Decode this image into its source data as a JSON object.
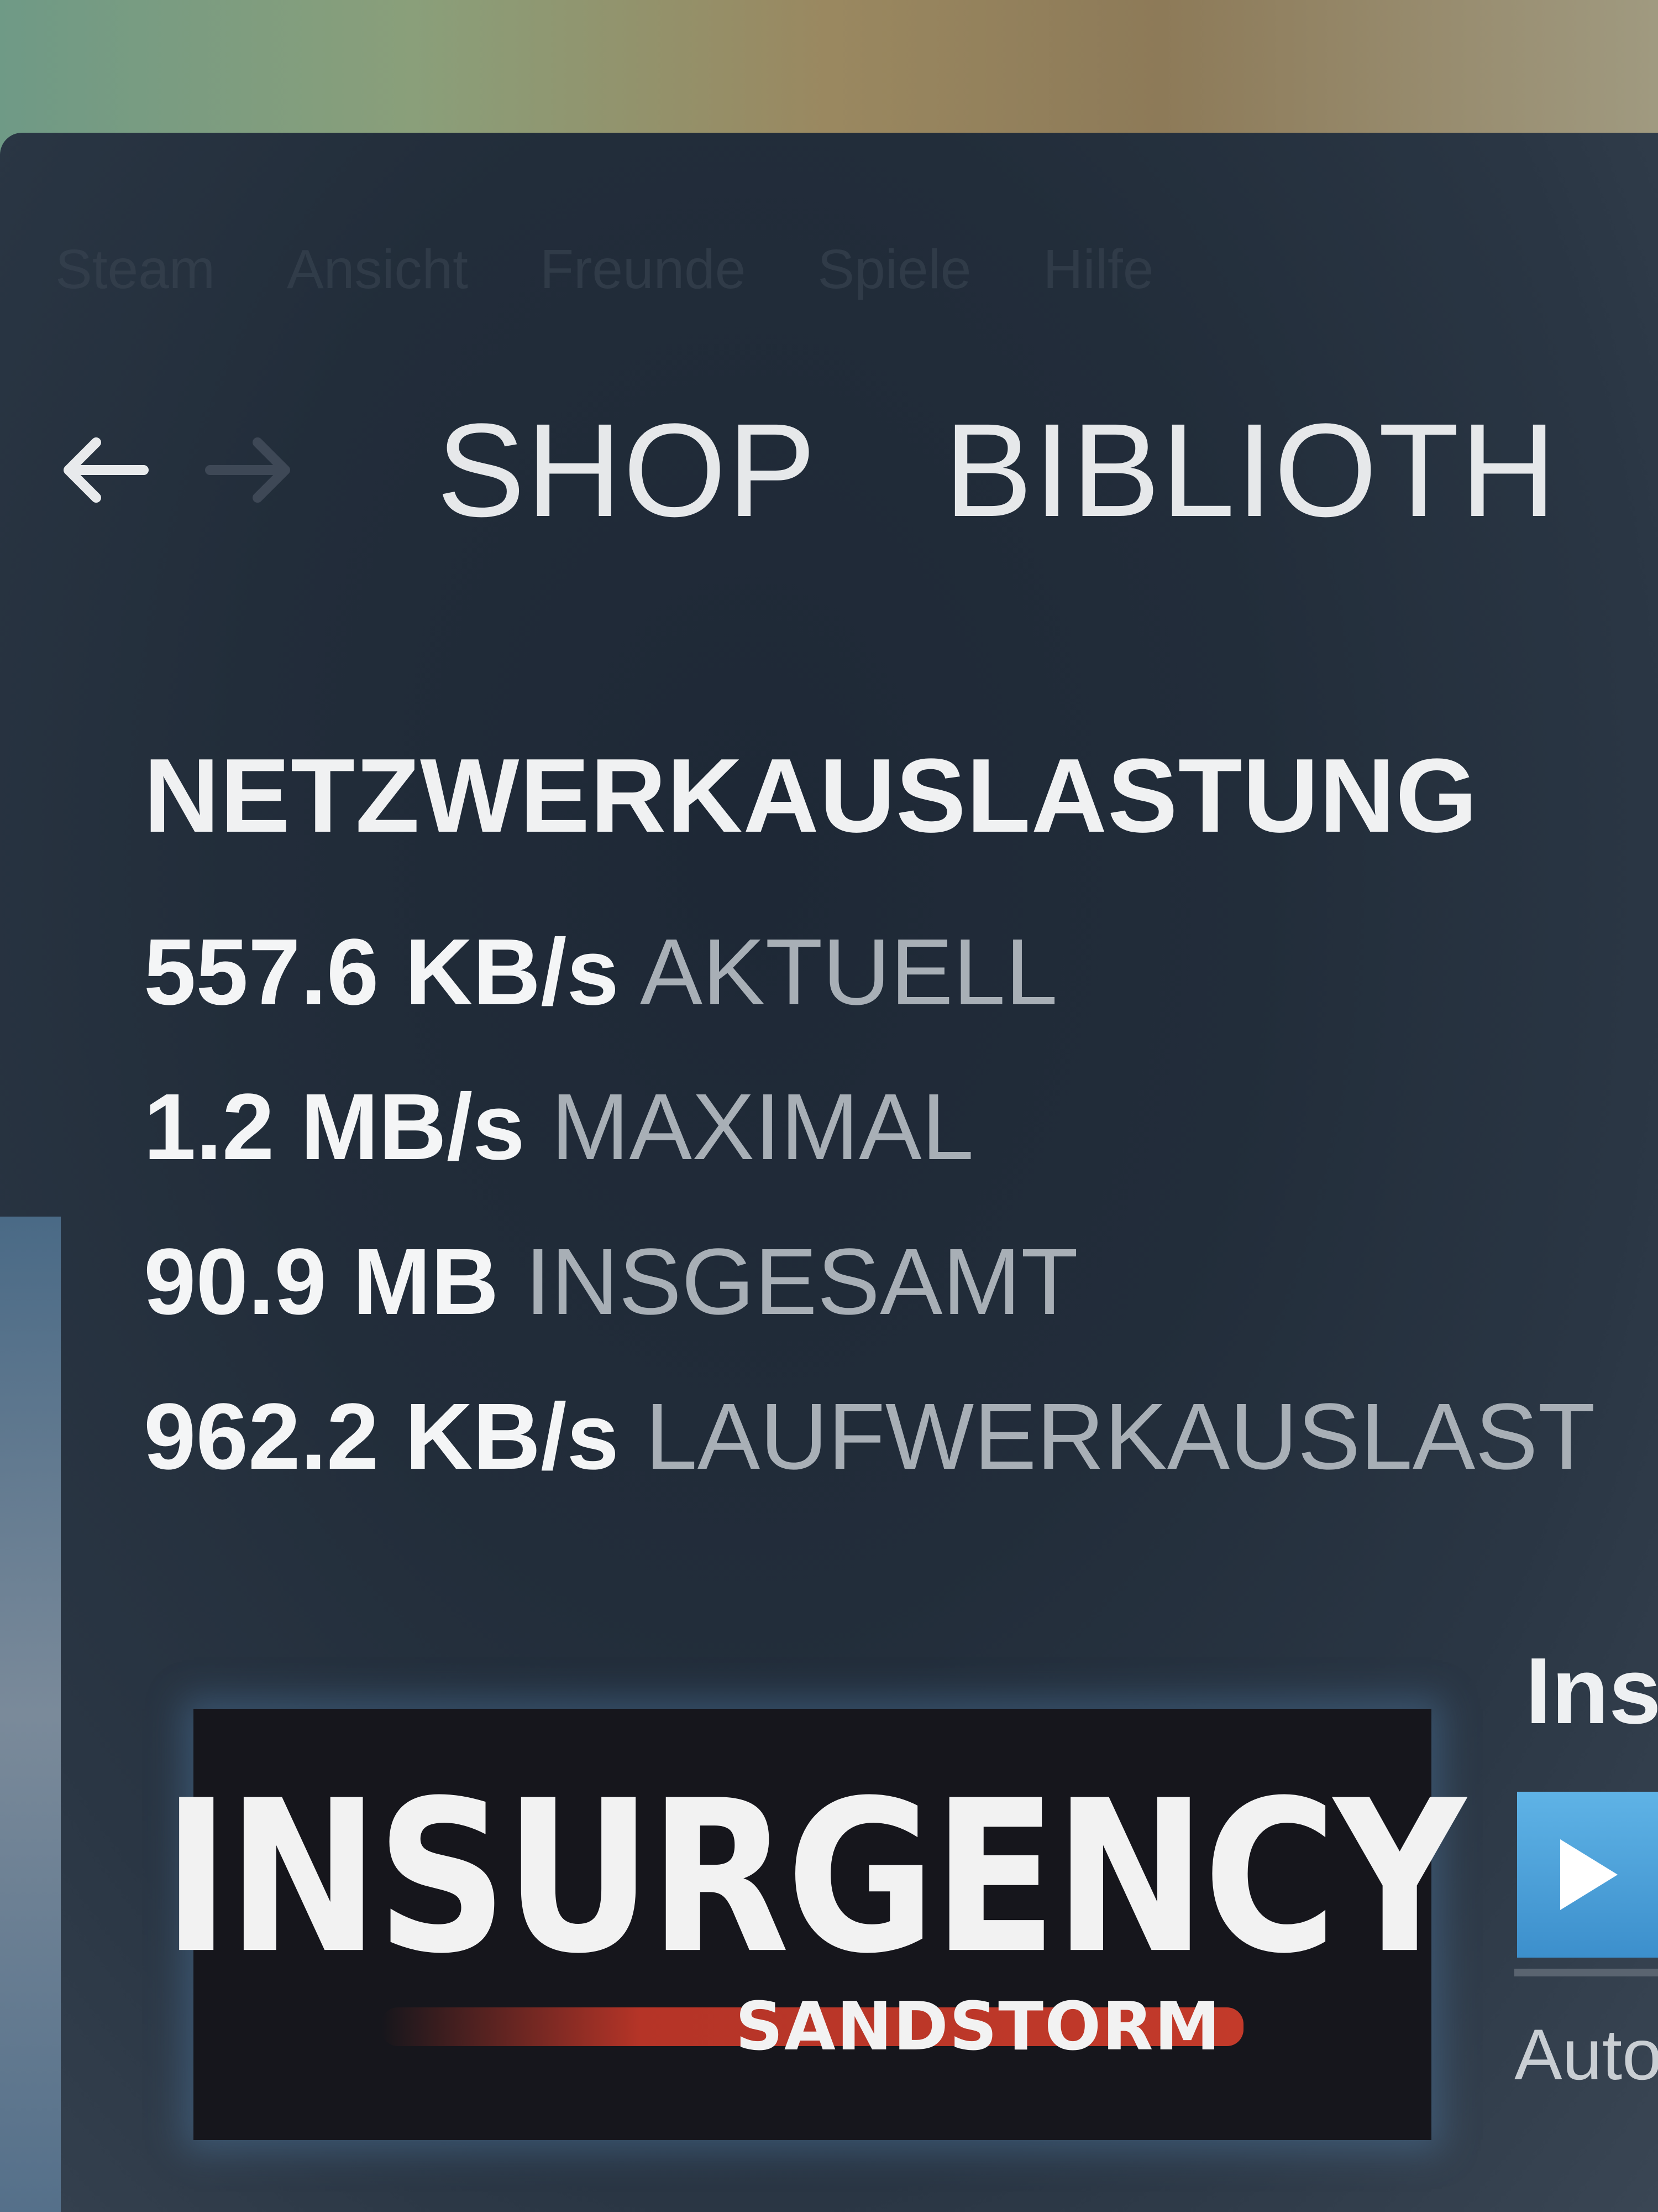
{
  "menubar": {
    "items": [
      "Steam",
      "Ansicht",
      "Freunde",
      "Spiele",
      "Hilfe"
    ]
  },
  "nav": {
    "back_icon": "arrow-left-icon",
    "forward_icon": "arrow-right-icon",
    "tabs": [
      {
        "label": "SHOP"
      },
      {
        "label": "BIBLIOTH"
      }
    ]
  },
  "network": {
    "title": "NETZWERKAUSLASTUNG",
    "rows": [
      {
        "value": "557.6 KB/s",
        "label": "AKTUELL"
      },
      {
        "value": "1.2 MB/s",
        "label": "MAXIMAL"
      },
      {
        "value": "90.9 MB",
        "label": "INSGESAMT"
      },
      {
        "value": "962.2 KB/s",
        "label": "LAUFWERKAUSLAST"
      }
    ]
  },
  "game": {
    "logo_main": "INSURGENCY",
    "logo_sub": "SANDSTORM",
    "side_title": "Ins",
    "play_icon": "play-icon",
    "side_status": "Auto",
    "accent_color": "#4aa3dc"
  }
}
